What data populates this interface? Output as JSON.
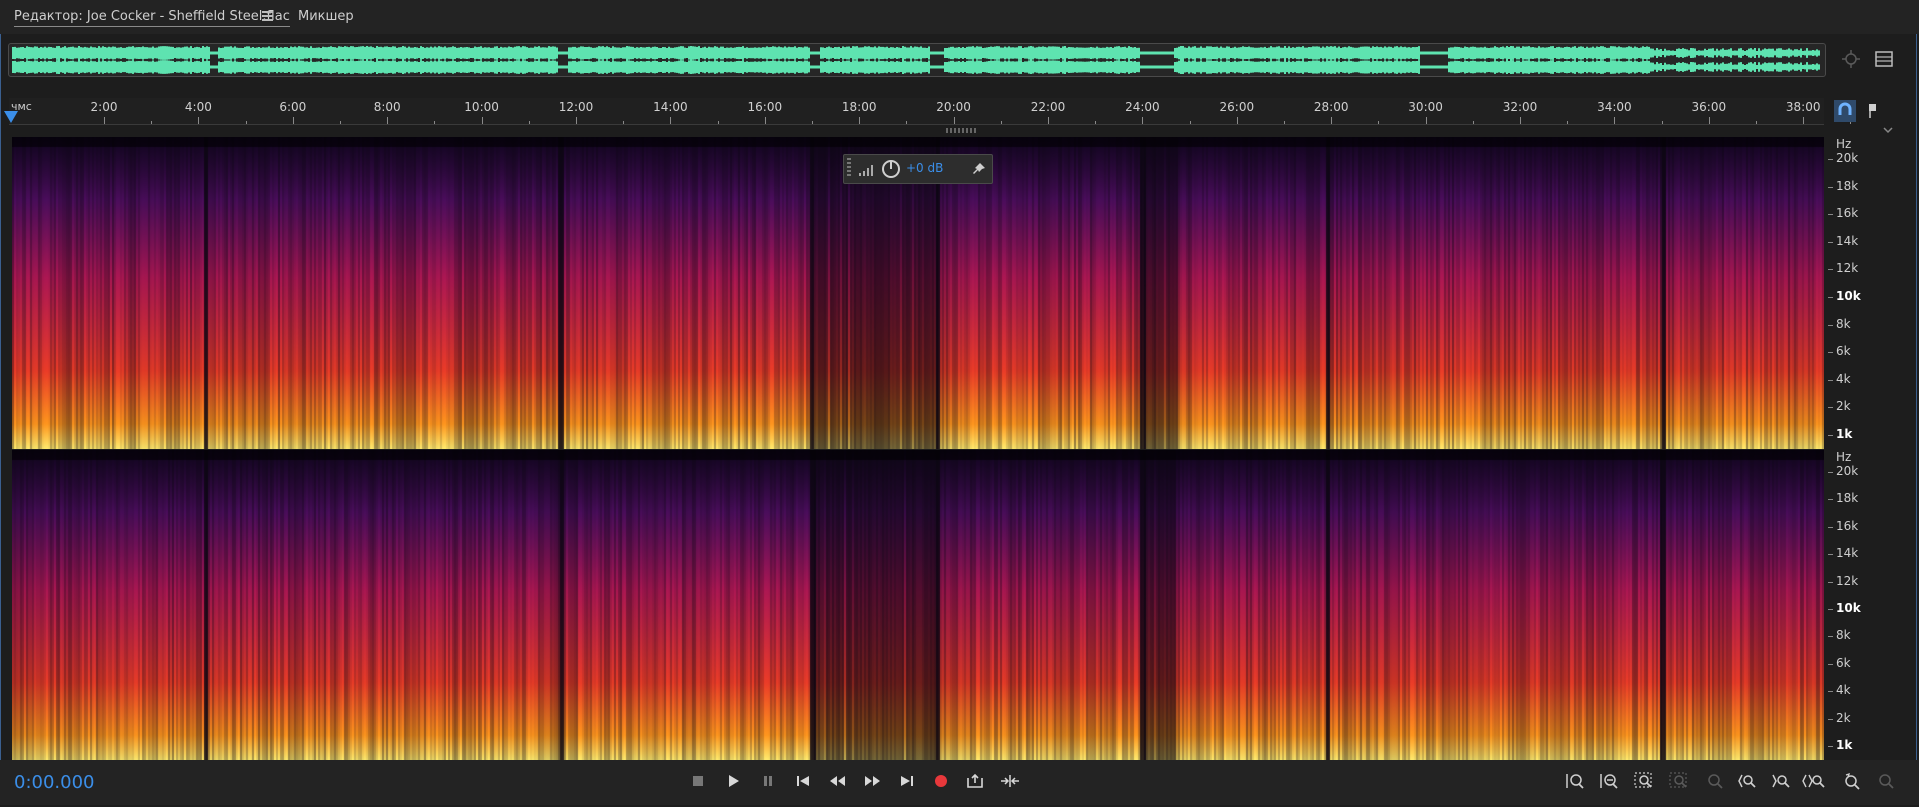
{
  "tabs": [
    {
      "label": "Редактор: Joe Cocker - Sheffield Steel.flac",
      "active": true
    },
    {
      "label": "Микшер",
      "active": false
    }
  ],
  "ruler": {
    "unit_label": "чмс",
    "labels": [
      "2:00",
      "4:00",
      "6:00",
      "8:00",
      "10:00",
      "12:00",
      "14:00",
      "16:00",
      "18:00",
      "20:00",
      "22:00",
      "24:00",
      "26:00",
      "28:00",
      "30:00",
      "32:00",
      "34:00",
      "36:00",
      "38:00"
    ]
  },
  "hud": {
    "gain": "+0 dB"
  },
  "frequency_axis": {
    "unit": "Hz",
    "labels": [
      "20k",
      "18k",
      "16k",
      "14k",
      "12k",
      "10k",
      "8k",
      "6k",
      "4k",
      "2k",
      "1k"
    ]
  },
  "transport": {
    "current_time": "0:00.000"
  },
  "colors": {
    "accent": "#3b8ee8",
    "waveform": "#5ee3b0",
    "record": "#e8383b"
  }
}
